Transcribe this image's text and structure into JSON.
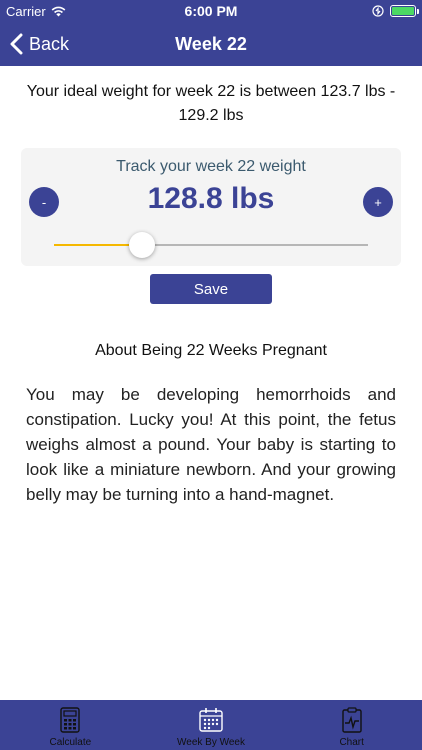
{
  "status": {
    "carrier": "Carrier",
    "time": "6:00 PM",
    "battery_color": "#4cd964"
  },
  "nav": {
    "back_label": "Back",
    "title": "Week 22"
  },
  "ideal_weight_text": "Your ideal weight for week 22 is between 123.7 lbs - 129.2 lbs",
  "tracker": {
    "label": "Track your week 22 weight",
    "value": "128.8 lbs",
    "minus_label": "-",
    "plus_label": "+",
    "slider_fraction": 0.28
  },
  "save_label": "Save",
  "about": {
    "title": "About Being 22 Weeks Pregnant",
    "body": "You may be developing hemorrhoids and constipation. Lucky you! At this point, the fetus weighs almost a pound. Your baby is starting to look like a miniature newborn. And your growing belly may be turning into a hand-magnet."
  },
  "tabs": [
    {
      "label": "Calculate",
      "icon": "calculator-icon"
    },
    {
      "label": "Week By Week",
      "icon": "calendar-icon"
    },
    {
      "label": "Chart",
      "icon": "chart-icon"
    }
  ],
  "colors": {
    "primary": "#3b4395",
    "slider_fill": "#f5b800",
    "card_bg": "#f4f4f4"
  }
}
